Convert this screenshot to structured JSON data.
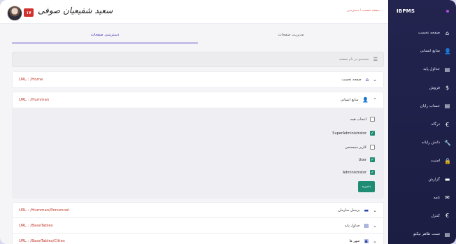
{
  "app": {
    "brand": "IBPMS"
  },
  "topbar": {
    "badge_count": "۱۷",
    "user_signature": "سعید شفیعیان صوفی",
    "breadcrumb": "صفحه نخست / دسترسی"
  },
  "sidebar": {
    "items": [
      {
        "label": "صفحه نخست",
        "icon": "home-icon",
        "glyph": "⌂"
      },
      {
        "label": "منابع انسانی",
        "icon": "user-icon",
        "glyph": "👤"
      },
      {
        "label": "جداول پایه",
        "icon": "file-icon",
        "glyph": "▤"
      },
      {
        "label": "فروش",
        "icon": "dollar-icon",
        "glyph": "$"
      },
      {
        "label": "حساب رایان",
        "icon": "file-icon",
        "glyph": "▤"
      },
      {
        "label": "درگاه",
        "icon": "euro-icon",
        "glyph": "€"
      },
      {
        "label": "دانش رایانه",
        "icon": "wrench-icon",
        "glyph": "🔧"
      },
      {
        "label": "امنیت",
        "icon": "lock-icon",
        "glyph": "🔒"
      },
      {
        "label": "گزارش",
        "icon": "folder-icon",
        "glyph": "▬"
      },
      {
        "label": "نامه",
        "icon": "mail-icon",
        "glyph": "✉"
      },
      {
        "label": "کنترل",
        "icon": "euro-icon",
        "glyph": "€"
      },
      {
        "label": "تست ظاهر تیکتو",
        "icon": "file-icon",
        "glyph": "▤"
      }
    ]
  },
  "tabs": [
    {
      "label": "مدیریت صفحات"
    },
    {
      "label": "دسترسی صفحات"
    }
  ],
  "search": {
    "placeholder": "جستجو در نام صفحه"
  },
  "panels": [
    {
      "title": "صفحه نخست",
      "url": "URL : /Home",
      "icon": "home-icon",
      "glyph": "⌂",
      "expanded": false,
      "chevron": "⌄"
    },
    {
      "title": "منابع انسانی",
      "url": "URL : /Humman",
      "icon": "user-icon",
      "glyph": "👤",
      "expanded": true,
      "chevron": "⌃",
      "permissions": [
        {
          "label": "انتخاب همه",
          "checked": false
        },
        {
          "label": "SuperAdministrator",
          "checked": true
        },
        {
          "label": "کاربر سیستمی",
          "checked": false
        },
        {
          "label": "User",
          "checked": true
        },
        {
          "label": "Administrator",
          "checked": true
        }
      ],
      "save_label": "ذخیره"
    },
    {
      "title": "پرسنل سازمان",
      "url": "URL : /Humman/Personnel",
      "icon": "folder-icon",
      "glyph": "▬",
      "expanded": false,
      "chevron": "⌄"
    },
    {
      "title": "جداول پایه",
      "url": "URL : /BaseTables",
      "icon": "file-icon",
      "glyph": "▤",
      "expanded": false,
      "chevron": "⌄"
    },
    {
      "title": "شهر ها",
      "url": "URL : /BaseTables/Cities",
      "icon": "image-icon",
      "glyph": "▣",
      "expanded": false,
      "chevron": "⌄"
    }
  ],
  "colors": {
    "accent": "#4b3ab8",
    "sidebar": "#23244f",
    "save": "#1f8c74",
    "url": "#c0392b",
    "badge": "#d0312d"
  }
}
